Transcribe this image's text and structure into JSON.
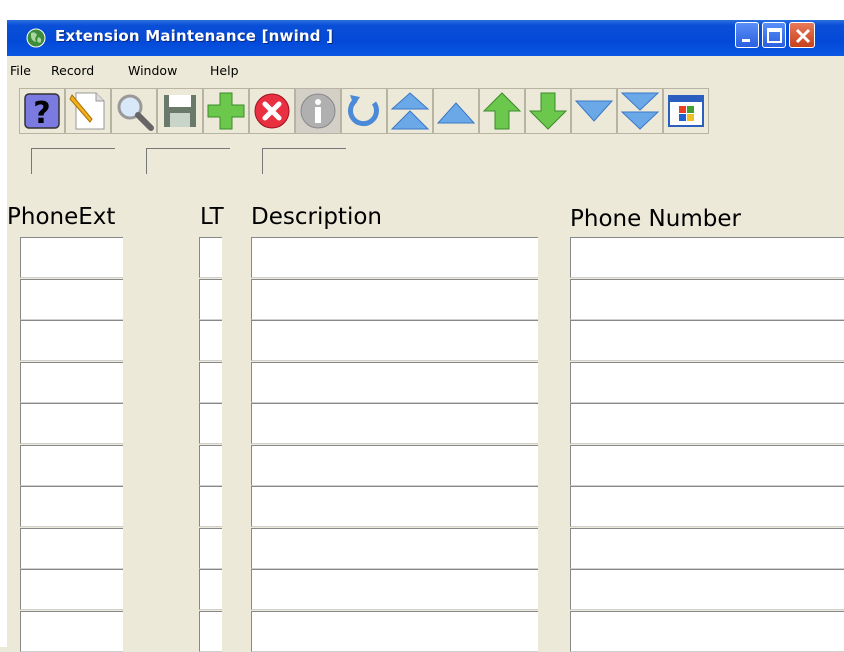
{
  "window": {
    "title": "Extension Maintenance [nwind   ]"
  },
  "menu": {
    "items": [
      "File",
      "Record",
      "Window",
      "Help"
    ]
  },
  "toolbar": {
    "buttons": [
      {
        "name": "help-icon"
      },
      {
        "name": "new-record-icon"
      },
      {
        "name": "search-icon"
      },
      {
        "name": "save-icon"
      },
      {
        "name": "add-icon"
      },
      {
        "name": "delete-icon"
      },
      {
        "name": "info-icon"
      },
      {
        "name": "refresh-icon"
      },
      {
        "name": "first-record-icon"
      },
      {
        "name": "previous-page-icon"
      },
      {
        "name": "previous-record-icon"
      },
      {
        "name": "next-record-icon"
      },
      {
        "name": "next-page-icon"
      },
      {
        "name": "last-record-icon"
      },
      {
        "name": "windows-icon"
      }
    ]
  },
  "table": {
    "headers": {
      "phone_ext": "PhoneExt",
      "lt": "LT",
      "description": "Description",
      "phone_number": "Phone Number"
    },
    "row_count": 10,
    "rows": [
      {
        "phone_ext": "",
        "lt": "",
        "description": "",
        "phone_number": ""
      },
      {
        "phone_ext": "",
        "lt": "",
        "description": "",
        "phone_number": ""
      },
      {
        "phone_ext": "",
        "lt": "",
        "description": "",
        "phone_number": ""
      },
      {
        "phone_ext": "",
        "lt": "",
        "description": "",
        "phone_number": ""
      },
      {
        "phone_ext": "",
        "lt": "",
        "description": "",
        "phone_number": ""
      },
      {
        "phone_ext": "",
        "lt": "",
        "description": "",
        "phone_number": ""
      },
      {
        "phone_ext": "",
        "lt": "",
        "description": "",
        "phone_number": ""
      },
      {
        "phone_ext": "",
        "lt": "",
        "description": "",
        "phone_number": ""
      },
      {
        "phone_ext": "",
        "lt": "",
        "description": "",
        "phone_number": ""
      },
      {
        "phone_ext": "",
        "lt": "",
        "description": "",
        "phone_number": ""
      }
    ]
  },
  "colors": {
    "titlebar": "#0349d8",
    "background": "#ece9d8",
    "field": "#ffffff"
  }
}
